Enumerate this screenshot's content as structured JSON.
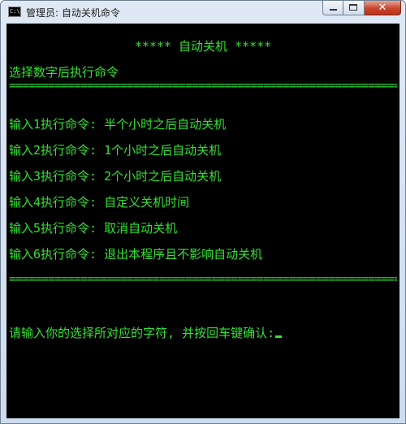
{
  "window": {
    "title": "管理员: 自动关机命令",
    "icon_name": "console-app-icon",
    "icon_text": "C:\\",
    "controls": {
      "minimize": "minimize-icon",
      "maximize": "maximize-icon",
      "close_glyph": "✕"
    }
  },
  "console": {
    "heading": "***** 自动关机 *****",
    "prompt_intro": "选择数字后执行命令",
    "rule_top": "==========================================================================",
    "options": [
      "输入1执行命令: 半个小时之后自动关机",
      "输入2执行命令: 1个小时之后自动关机",
      "输入3执行命令: 2个小时之后自动关机",
      "输入4执行命令: 自定义关机时间",
      "输入5执行命令: 取消自动关机",
      "输入6执行命令: 退出本程序且不影响自动关机"
    ],
    "rule_bottom": "==========================================================================",
    "input_prompt": "请输入你的选择所对应的字符, 并按回车键确认:"
  },
  "colors": {
    "console_bg": "#000000",
    "console_text": "#33e133",
    "close_button": "#c9462c"
  }
}
